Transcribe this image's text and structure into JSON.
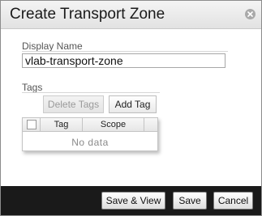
{
  "dialog": {
    "title": "Create Transport Zone",
    "close_icon": "close-circle-icon"
  },
  "form": {
    "display_name_label": "Display Name",
    "display_name_value": "vlab-transport-zone",
    "tags_label": "Tags",
    "delete_tags_label": "Delete Tags",
    "delete_tags_enabled": false,
    "add_tag_label": "Add Tag"
  },
  "tags_grid": {
    "columns": [
      "Tag",
      "Scope"
    ],
    "empty_text": "No data"
  },
  "footer": {
    "save_view_label": "Save & View",
    "save_label": "Save",
    "cancel_label": "Cancel"
  }
}
